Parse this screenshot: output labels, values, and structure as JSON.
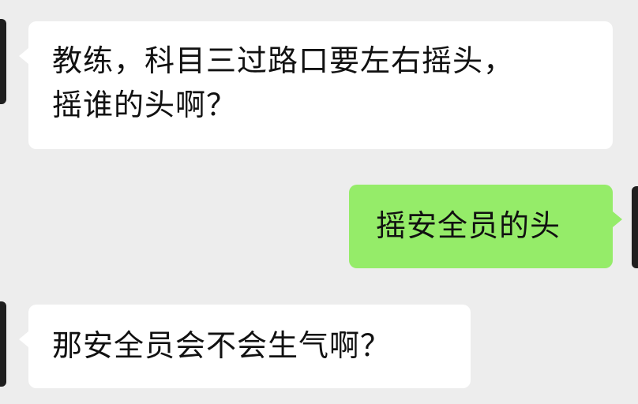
{
  "chat": {
    "messages": [
      {
        "sender": "incoming",
        "lines": [
          "教练，科目三过路口要左右摇头，",
          "摇谁的头啊？"
        ]
      },
      {
        "sender": "outgoing",
        "lines": [
          "摇安全员的头"
        ]
      },
      {
        "sender": "incoming",
        "lines": [
          "那安全员会不会生气啊？"
        ]
      }
    ]
  },
  "colors": {
    "background": "#ededed",
    "incoming_bubble": "#ffffff",
    "outgoing_bubble": "#95ec69",
    "text": "#111111"
  }
}
